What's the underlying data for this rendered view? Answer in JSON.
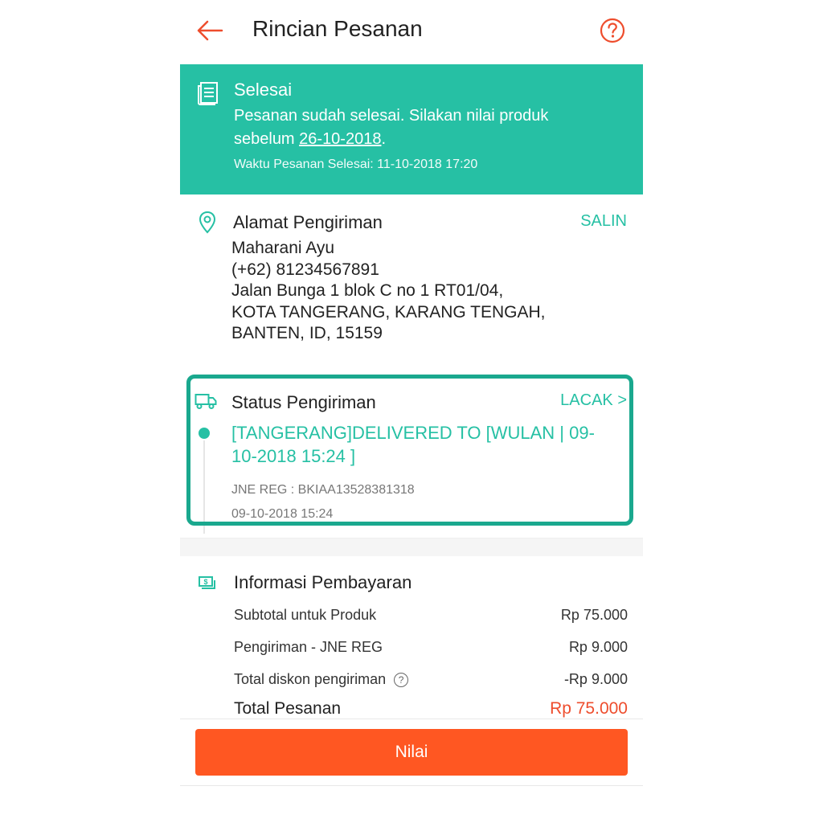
{
  "header": {
    "title": "Rincian Pesanan",
    "back_icon": "arrow-left-icon",
    "help_icon": "question-circle-icon"
  },
  "colors": {
    "accent": "#26c0a4",
    "accent_dark": "#1aa88e",
    "primary_button": "#ff5722",
    "price": "#ee4d2d"
  },
  "order_status": {
    "icon": "document-icon",
    "title": "Selesai",
    "message_prefix": "Pesanan sudah selesai. Silakan nilai produk sebelum ",
    "message_date": "26-10-2018",
    "message_suffix": ".",
    "completed_time": "Waktu Pesanan Selesai: 11-10-2018 17:20"
  },
  "shipping_address": {
    "icon": "location-pin-icon",
    "title": "Alamat Pengiriman",
    "action": "SALIN",
    "lines": [
      "Maharani Ayu",
      "(+62) 81234567891",
      "Jalan Bunga 1 blok C no 1 RT01/04,",
      "KOTA TANGERANG, KARANG TENGAH,",
      "BANTEN, ID, 15159"
    ]
  },
  "shipping_status": {
    "icon": "truck-icon",
    "title": "Status Pengiriman",
    "action": "LACAK >",
    "latest_update": "[TANGERANG]DELIVERED TO [WULAN | 09-10-2018 15:24 ]",
    "courier": "JNE REG :  BKIAA13528381318",
    "timestamp": "09-10-2018 15:24"
  },
  "payment": {
    "icon": "money-icon",
    "title": "Informasi Pembayaran",
    "rows": [
      {
        "label": "Subtotal untuk Produk",
        "amount": "Rp 75.000"
      },
      {
        "label": "Pengiriman - JNE REG",
        "amount": "Rp 9.000"
      },
      {
        "label": "Total diskon pengiriman",
        "amount": "-Rp 9.000",
        "help": "?"
      }
    ],
    "total_label": "Total Pesanan",
    "total_amount": "Rp 75.000"
  },
  "footer": {
    "rate_button": "Nilai"
  }
}
